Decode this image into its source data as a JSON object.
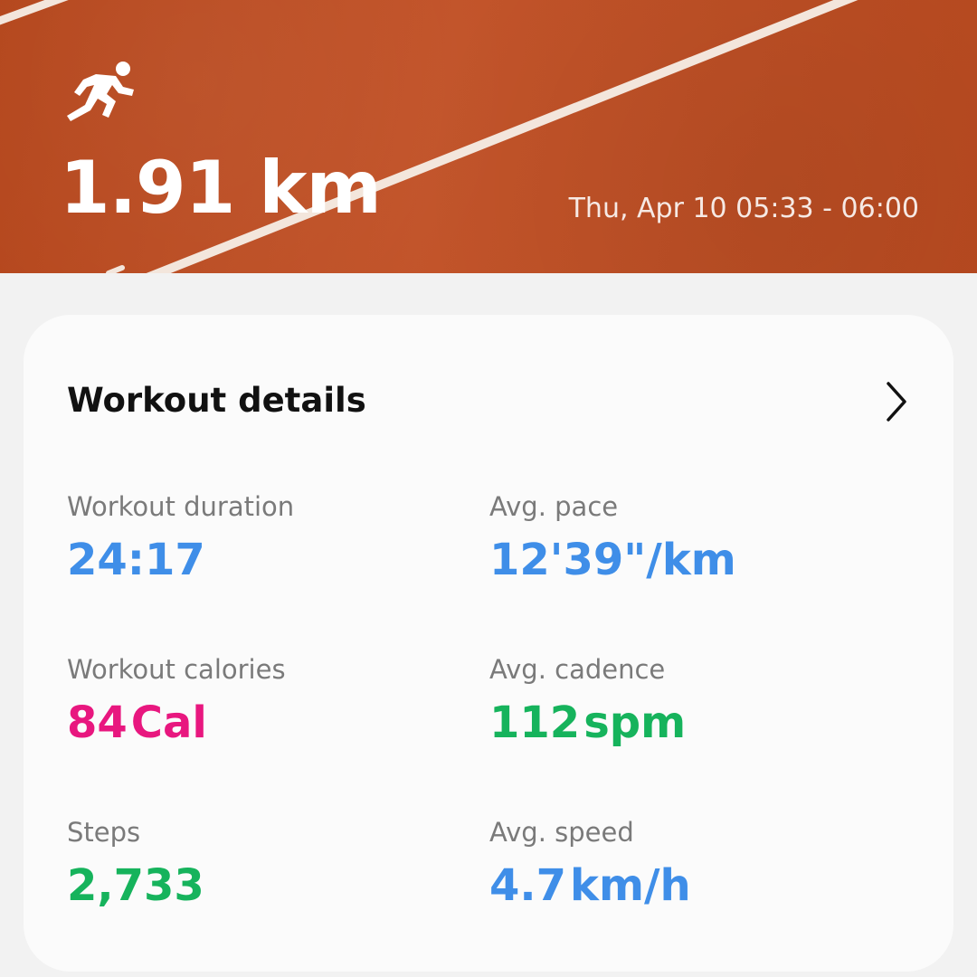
{
  "header": {
    "activity_icon": "running-icon",
    "distance": "1.91 km",
    "time_range": "Thu, Apr 10 05:33 - 06:00"
  },
  "details": {
    "title": "Workout details",
    "open_icon": "chevron-right-icon",
    "metrics": [
      {
        "label": "Workout duration",
        "value": "24:17",
        "unit": "",
        "color": "#3f8ee8"
      },
      {
        "label": "Avg. pace",
        "value": "12'39\"/km",
        "unit": "",
        "color": "#3f8ee8"
      },
      {
        "label": "Workout calories",
        "value": "84",
        "unit": "Cal",
        "color": "#e8177f"
      },
      {
        "label": "Avg. cadence",
        "value": "112",
        "unit": "spm",
        "color": "#16b35c"
      },
      {
        "label": "Steps",
        "value": "2,733",
        "unit": "",
        "color": "#16b35c"
      },
      {
        "label": "Avg. speed",
        "value": "4.7",
        "unit": "km/h",
        "color": "#3f8ee8"
      }
    ]
  },
  "colors": {
    "track": "#bd4f24",
    "card_background": "#fbfbfb",
    "page_background": "#f2f2f2"
  }
}
